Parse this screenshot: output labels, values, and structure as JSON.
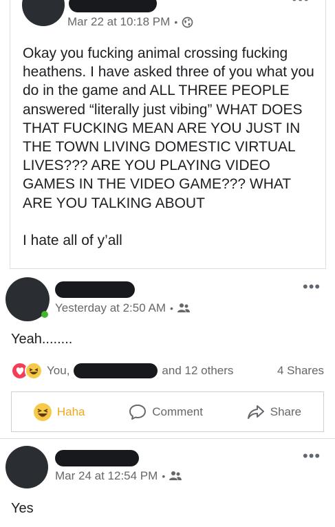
{
  "post": {
    "timestamp": "Mar 22 at 10:18 PM",
    "text_p1": "Okay you fucking animal crossing fucking heathens. I have asked three of you what you do in the game and ALL THREE PEOPLE answered “literally just vibing” WHAT DOES THAT FUCKING MEAN ARE YOU JUST IN THE TOWN LIVING DOMESTIC VIRTUAL LIVES??? ARE YOU PLAYING VIDEO GAMES IN THE VIDEO GAME??? WHAT ARE YOU TALKING ABOUT",
    "text_p2": "I hate all of y’all",
    "privacy_icon": "globe-icon"
  },
  "shared_post": {
    "timestamp": "Yesterday at 2:50 AM",
    "privacy_icon": "friends-icon",
    "text": "Yeah........",
    "reactions": {
      "names_prefix": "You,",
      "names_suffix": "and 12 others",
      "shares": "4 Shares"
    },
    "actions": {
      "haha": "Haha",
      "comment": "Comment",
      "share": "Share"
    }
  },
  "next_post": {
    "timestamp": "Mar 24 at 12:54 PM",
    "privacy_icon": "friends-icon",
    "text": "Yes"
  },
  "colors": {
    "text": "#1c1e21",
    "meta": "#65676b",
    "haha": "#f2a619",
    "border": "#dadde1"
  }
}
